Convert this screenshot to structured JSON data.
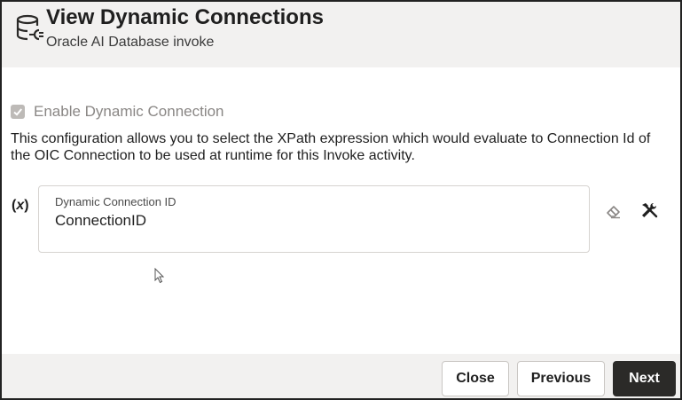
{
  "header": {
    "title": "View Dynamic Connections",
    "subtitle": "Oracle AI Database invoke",
    "icon": "database-connection-icon"
  },
  "body": {
    "checkbox": {
      "label": "Enable Dynamic Connection",
      "checked": true,
      "disabled": true
    },
    "description": "This configuration allows you to select the XPath expression which would evaluate to Connection Id of the OIC Connection to be used at runtime for this Invoke activity.",
    "expression_marker": {
      "open": "(",
      "symbol": "x",
      "close": ")"
    },
    "field": {
      "label": "Dynamic Connection ID",
      "value": "ConnectionID"
    },
    "actions": {
      "clear_icon": "eraser-icon",
      "mapper_icon": "tools-icon"
    }
  },
  "footer": {
    "close_label": "Close",
    "previous_label": "Previous",
    "next_label": "Next"
  },
  "colors": {
    "header_bg": "#f2f1f0",
    "primary_button": "#2b2a28",
    "disabled_text": "#8a8785"
  }
}
